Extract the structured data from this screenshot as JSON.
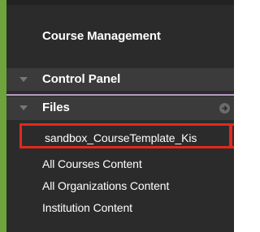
{
  "course_management": {
    "title": "Course Management"
  },
  "control_panel": {
    "label": "Control Panel",
    "icon": "collapse-triangle-icon"
  },
  "files": {
    "label": "Files",
    "icon": "collapse-triangle-icon",
    "action_icon": "arrow-circle-icon",
    "items": [
      {
        "label": "sandbox_CourseTemplate_Kis",
        "highlighted": true
      },
      {
        "label": "All Courses Content"
      },
      {
        "label": "All Organizations Content"
      },
      {
        "label": "Institution Content"
      }
    ]
  },
  "colors": {
    "panel_bg": "#2b2b2b",
    "row_bg": "#3b3b3b",
    "accent_green": "#6fa33b",
    "divider": "#b79bc4",
    "highlight": "#e2281b"
  }
}
